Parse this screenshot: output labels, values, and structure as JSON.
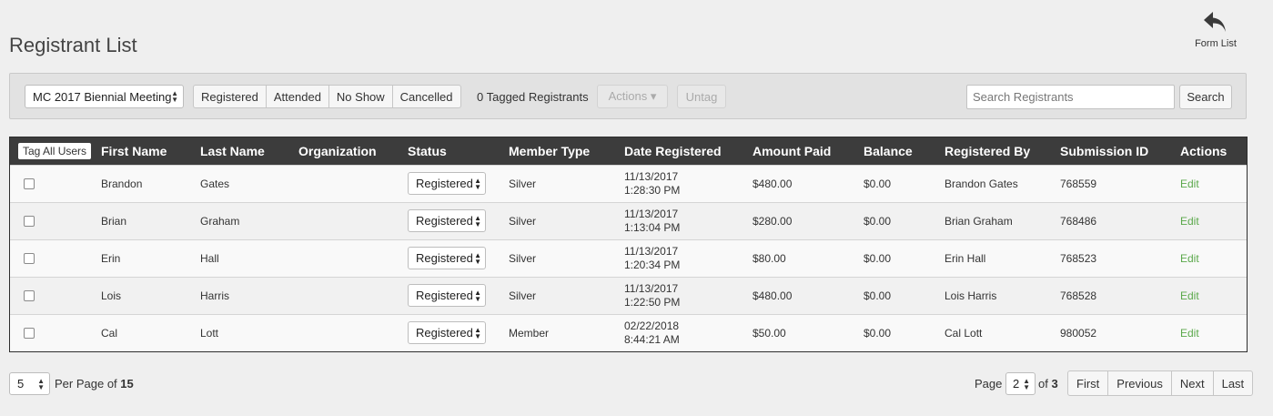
{
  "page": {
    "title": "Registrant List"
  },
  "nav": {
    "form_list_label": "Form List",
    "icon": "reply-arrow-icon"
  },
  "toolbar": {
    "event_select_value": "MC 2017 Biennial Meeting",
    "status_tabs": [
      "Registered",
      "Attended",
      "No Show",
      "Cancelled"
    ],
    "tagged_count": "0 Tagged Registrants",
    "actions_label": "Actions ▾",
    "untag_label": "Untag",
    "search_placeholder": "Search Registrants",
    "search_button": "Search"
  },
  "table": {
    "tag_all_label": "Tag All Users",
    "columns": [
      "First Name",
      "Last Name",
      "Organization",
      "Status",
      "Member Type",
      "Date Registered",
      "Amount Paid",
      "Balance",
      "Registered By",
      "Submission ID",
      "Actions"
    ],
    "rows": [
      {
        "first": "Brandon",
        "last": "Gates",
        "org": "",
        "status": "Registered",
        "member_type": "Silver",
        "date": "11/13/2017",
        "time": "1:28:30 PM",
        "paid": "$480.00",
        "balance": "$0.00",
        "by": "Brandon Gates",
        "submission": "768559",
        "action": "Edit"
      },
      {
        "first": "Brian",
        "last": "Graham",
        "org": "",
        "status": "Registered",
        "member_type": "Silver",
        "date": "11/13/2017",
        "time": "1:13:04 PM",
        "paid": "$280.00",
        "balance": "$0.00",
        "by": "Brian Graham",
        "submission": "768486",
        "action": "Edit"
      },
      {
        "first": "Erin",
        "last": "Hall",
        "org": "",
        "status": "Registered",
        "member_type": "Silver",
        "date": "11/13/2017",
        "time": "1:20:34 PM",
        "paid": "$80.00",
        "balance": "$0.00",
        "by": "Erin Hall",
        "submission": "768523",
        "action": "Edit"
      },
      {
        "first": "Lois",
        "last": "Harris",
        "org": "",
        "status": "Registered",
        "member_type": "Silver",
        "date": "11/13/2017",
        "time": "1:22:50 PM",
        "paid": "$480.00",
        "balance": "$0.00",
        "by": "Lois Harris",
        "submission": "768528",
        "action": "Edit"
      },
      {
        "first": "Cal",
        "last": "Lott",
        "org": "",
        "status": "Registered",
        "member_type": "Member",
        "date": "02/22/2018",
        "time": "8:44:21 AM",
        "paid": "$50.00",
        "balance": "$0.00",
        "by": "Cal Lott",
        "submission": "980052",
        "action": "Edit"
      }
    ]
  },
  "pagination": {
    "per_page_value": "5",
    "per_page_label": "Per Page of",
    "total": "15",
    "page_label": "Page",
    "current_page": "2",
    "of_label": "of",
    "total_pages": "3",
    "buttons": [
      "First",
      "Previous",
      "Next",
      "Last"
    ]
  },
  "colors": {
    "header_bg": "#3c3c3c",
    "edit_link": "#5aa84a",
    "page_bg": "#efefef"
  }
}
